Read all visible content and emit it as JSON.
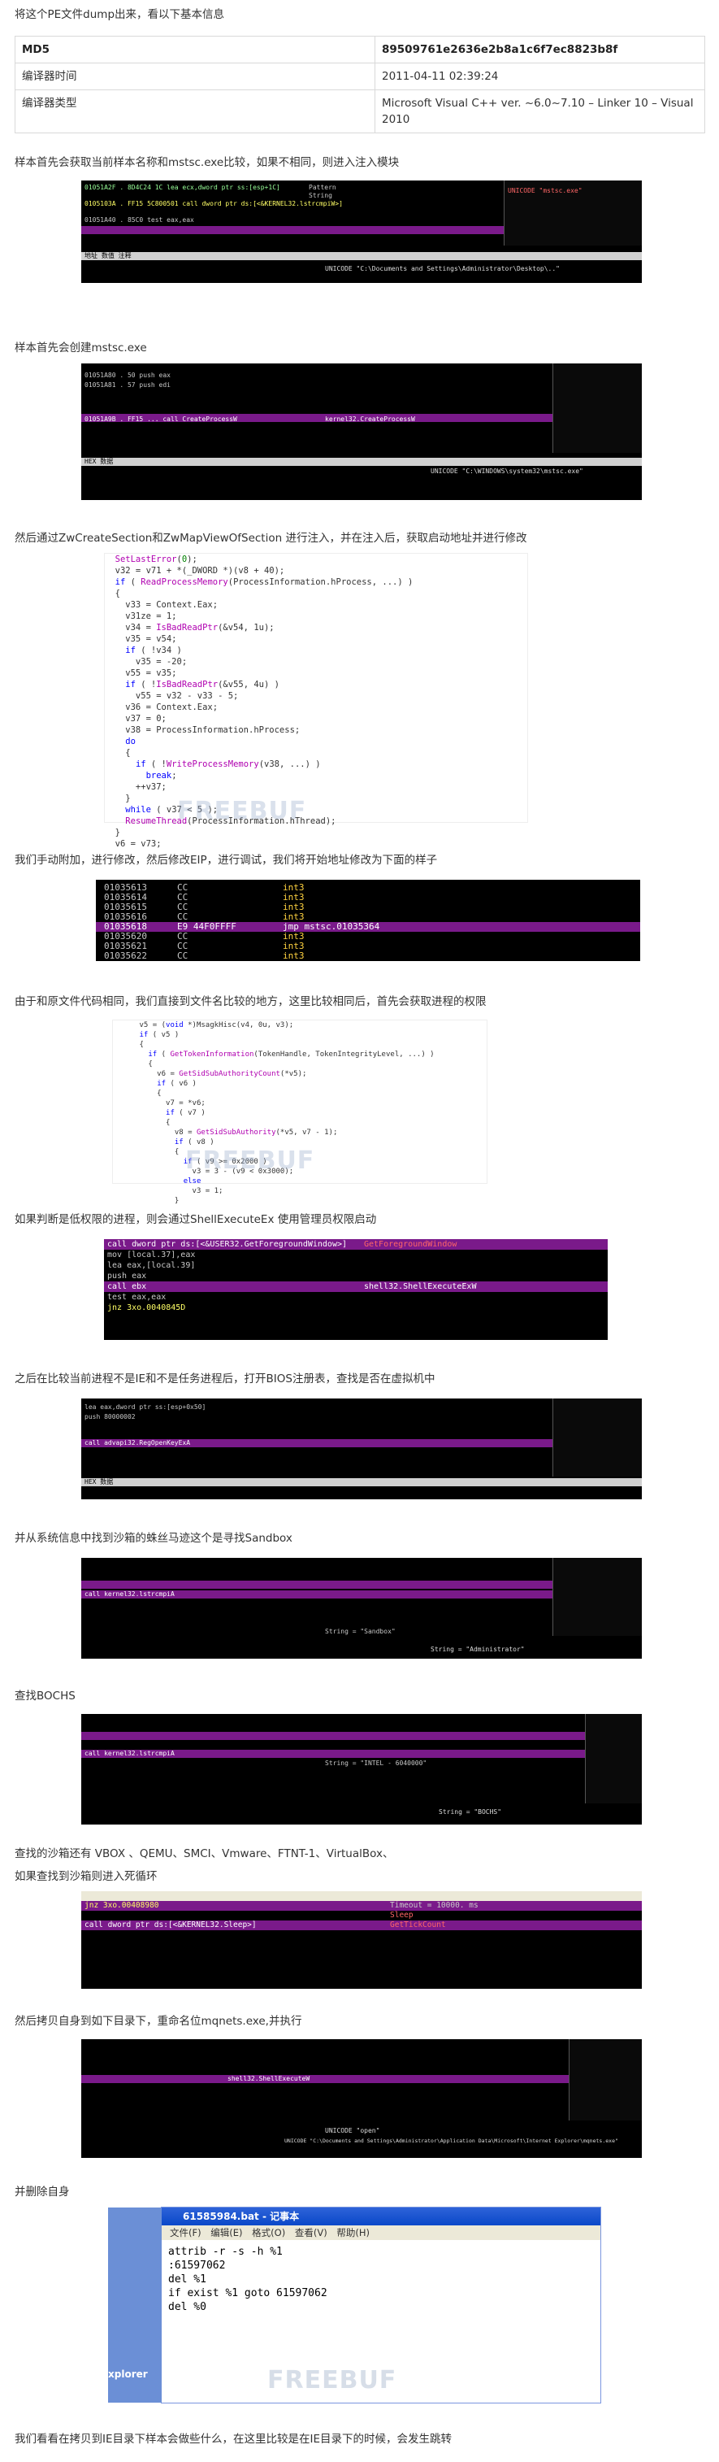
{
  "intro": "将这个PE文件dump出来，看以下基本信息",
  "info_table": [
    {
      "key": "MD5",
      "value": "89509761e2636e2b8a1c6f7ec8823b8f"
    },
    {
      "key": "编译器时间",
      "value": "2011-04-11 02:39:24"
    },
    {
      "key": "编译器类型",
      "value": "Microsoft Visual C++ ver. ~6.0~7.10 – Linker 10 – Visual 2010"
    }
  ],
  "paragraphs": [
    "样本首先会获取当前样本名称和mstsc.exe比较，如果不相同，则进入注入模块",
    "样本首先会创建mstsc.exe",
    "然后通过ZwCreateSection和ZwMapViewOfSection 进行注入，并在注入后，获取启动地址并进行修改",
    "我们手动附加，进行修改，然后修改EIP，进行调试，我们将开始地址修改为下面的样子",
    "由于和原文件代码相同，我们直接到文件名比较的地方，这里比较相同后，首先会获取进程的权限",
    "如果判断是低权限的进程，则会通过ShellExecuteEx 使用管理员权限启动",
    "之后在比较当前进程不是IE和不是任务进程后，打开BIOS注册表，查找是否在虚拟机中",
    "并从系统信息中找到沙箱的蛛丝马迹这个是寻找Sandbox",
    "查找BOCHS",
    "查找的沙箱还有 VBOX 、QEMU、SMCI、Vmware、FTNT-1、VirtualBox、",
    "如果查找到沙箱则进入死循环",
    "然后拷贝自身到如下目录下，重命名位mqnets.exe,并执行",
    "并删除自身",
    "我们看看在拷贝到IE目录下样本会做些什么，在这里比较是在IE目录下的时候，会发生跳转"
  ],
  "shots": {
    "s1": [
      "Pattern",
      "String",
      "UNICODE \"mstsc.exe\"",
      "UNICODE \"C:\\Documents and Settings\\Administrator\\Desktop\\..\""
    ],
    "s2": [
      "kernel32.CreateProcessW",
      "UNICODE \"C:\\WINDOWS\\system32\\mstsc.exe\""
    ],
    "s3": [
      "int3",
      "jmp mstsc.01035364"
    ],
    "s5": [
      "shell32.ShellExecuteExW",
      "GetForegroundWindow"
    ],
    "s7": [
      "String = \"Administrator\"",
      "String = \"Sandbox\""
    ],
    "s8": [
      "String = \"INTEL  - 6040000\"",
      "String = \"BOCHS\""
    ],
    "s9": [
      "Timeout = 10000. ms",
      "Sleep",
      "GetTickCount"
    ],
    "s10": [
      "shell32.ShellExecuteW",
      "UNICODE \"open\"",
      "UNICODE \"C:\\Documents and Settings\\Administrator\\Application Data\\Microsoft\\Internet Explorer\\mqnets.exe\""
    ]
  },
  "disasm_s3": [
    {
      "addr": "01035613",
      "hex": "CC",
      "op": "int3"
    },
    {
      "addr": "01035614",
      "hex": "CC",
      "op": "int3"
    },
    {
      "addr": "01035615",
      "hex": "CC",
      "op": "int3"
    },
    {
      "addr": "01035616",
      "hex": "CC",
      "op": "int3"
    },
    {
      "addr": "01035618",
      "hex": "E9 44F0FFFF",
      "op": "jmp mstsc.01035364"
    },
    {
      "addr": "01035620",
      "hex": "CC",
      "op": "int3"
    },
    {
      "addr": "01035621",
      "hex": "CC",
      "op": "int3"
    },
    {
      "addr": "01035622",
      "hex": "CC",
      "op": "int3"
    }
  ],
  "notepad": {
    "title": "61585984.bat - 记事本",
    "menu": [
      "文件(F)",
      "编辑(E)",
      "格式(O)",
      "查看(V)",
      "帮助(H)"
    ],
    "lines": [
      "attrib -r -s -h %1",
      ":61597062",
      "del %1",
      "if exist %1 goto 61597062",
      "del %0"
    ],
    "side_label": "xplorer"
  },
  "watermark": "FREEBUF"
}
